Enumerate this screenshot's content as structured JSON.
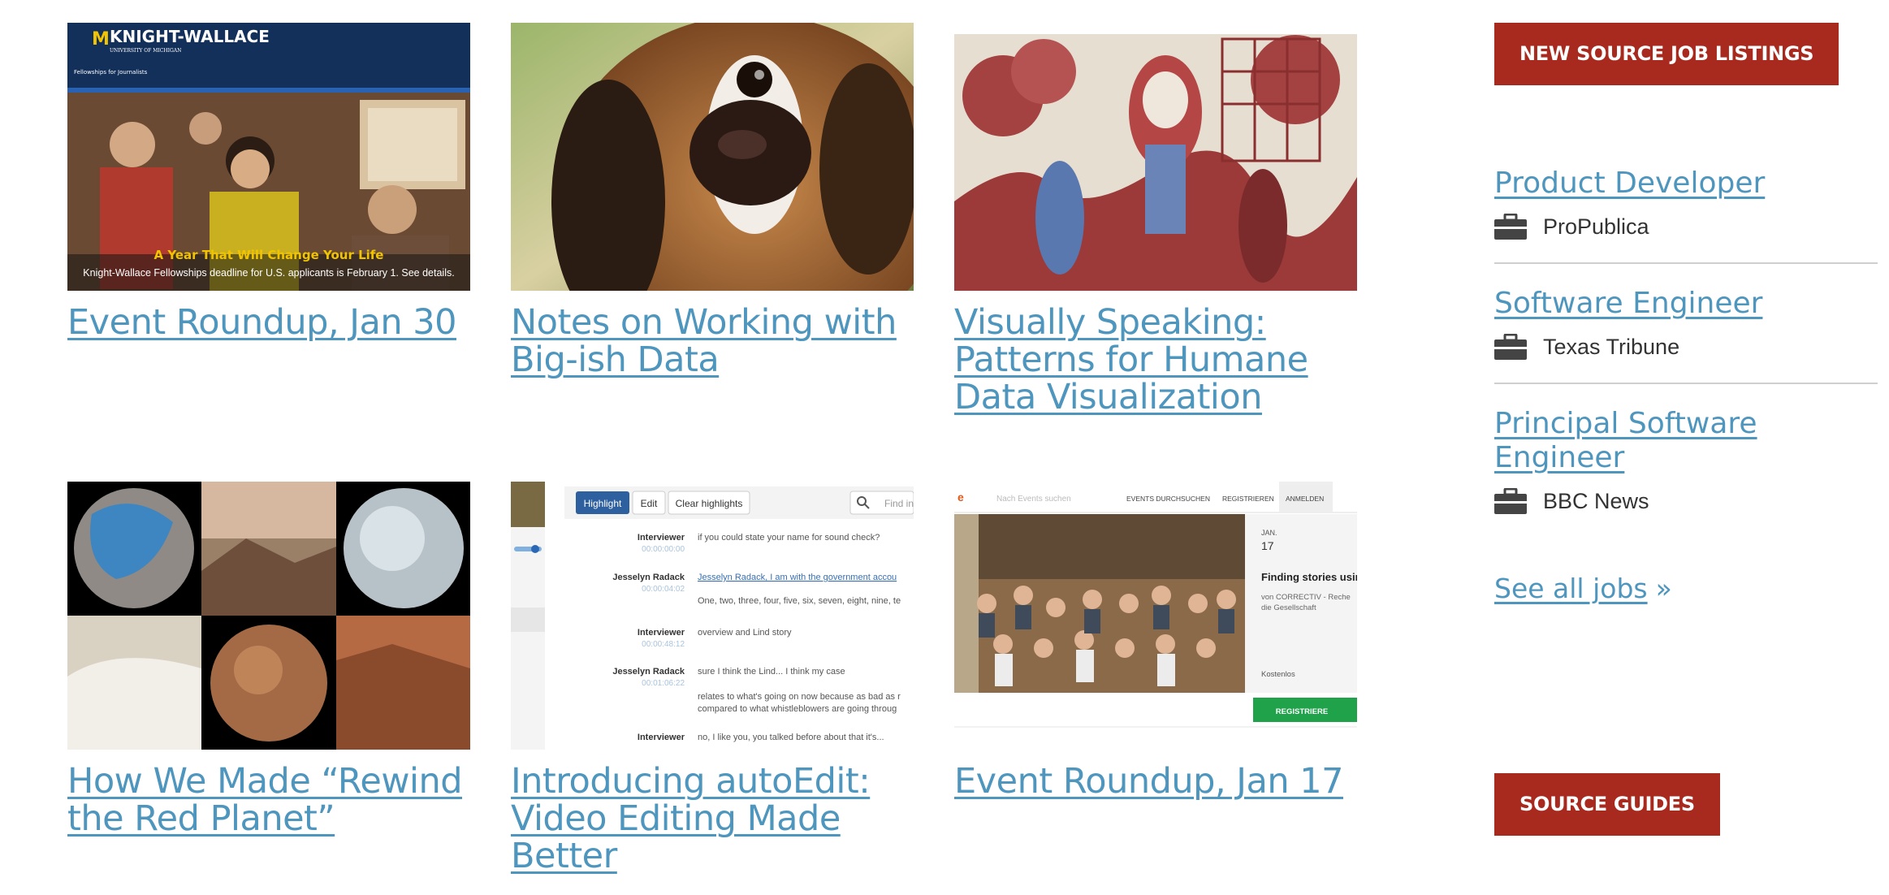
{
  "articles": [
    {
      "title": "Event Roundup, Jan 30",
      "thumb": {
        "logo_text": "KNIGHT-WALLACE",
        "sub_text": "UNIVERSITY OF MICHIGAN",
        "tag_text": "Fellowships for Journalists",
        "headline": "A Year That Will Change Your Life",
        "caption": "Knight-Wallace Fellowships deadline for U.S. applicants is February 1. See details."
      }
    },
    {
      "title": "Notes on Working with Big-ish Data"
    },
    {
      "title": "Visually Speaking: Patterns for Humane Data Visualization"
    },
    {
      "title": "How We Made “Rewind the Red Planet”"
    },
    {
      "title": "Introducing autoEdit: Video Editing Made Better",
      "thumb": {
        "buttons": [
          "Highlight",
          "Edit",
          "Clear highlights"
        ],
        "search_placeholder": "Find in",
        "rows": [
          {
            "speaker": "Interviewer",
            "time": "00:00:00:00",
            "text": "if you could state your name for sound check?"
          },
          {
            "speaker": "Jesselyn Radack",
            "time": "00:00:04:02",
            "text": "Jesselyn Radack, I am with the government accou",
            "extra": "One, two, three, four, five, six, seven, eight, nine, te"
          },
          {
            "speaker": "Interviewer",
            "time": "00:00:48:12",
            "text": "overview and Lind story"
          },
          {
            "speaker": "Jesselyn Radack",
            "time": "00:01:06:22",
            "text": "sure I think the Lind... I think my case",
            "extra": "relates to what's going on now because as bad as r",
            "extra2": "compared to what whistleblowers are going throug"
          },
          {
            "speaker": "Interviewer",
            "time": "",
            "text": "no, I like you, you talked before about that it's..."
          }
        ]
      }
    },
    {
      "title": "Event Roundup, Jan 17",
      "thumb": {
        "search_placeholder": "Nach Events suchen",
        "nav": [
          "EVENTS DURCHSUCHEN",
          "REGISTRIEREN",
          "ANMELDEN"
        ],
        "month": "JAN.",
        "day": "17",
        "event_title": "Finding stories usin",
        "event_org": "von CORRECTIV - Reche",
        "event_org2": "die Gesellschaft",
        "price": "Kostenlos",
        "register": "REGISTRIERE"
      }
    }
  ],
  "sidebar": {
    "jobs_button": "NEW SOURCE JOB LISTINGS",
    "jobs": [
      {
        "title": "Product Developer",
        "org": "ProPublica"
      },
      {
        "title": "Software Engineer",
        "org": "Texas Tribune"
      },
      {
        "title": "Principal Software Engineer",
        "org": "BBC News"
      }
    ],
    "see_all": "See all jobs",
    "see_all_arrow": "»",
    "guides_button": "SOURCE GUIDES"
  },
  "colors": {
    "link": "#4e96bd",
    "button": "#a8291e"
  },
  "icons": {
    "job_org": "briefcase-icon"
  }
}
